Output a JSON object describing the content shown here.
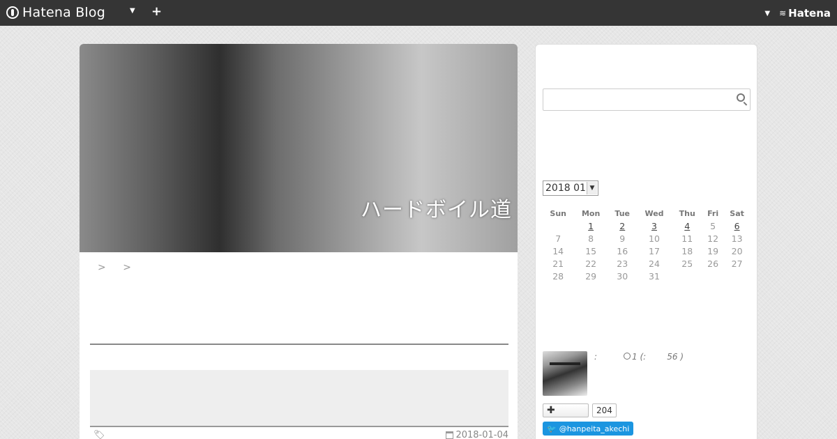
{
  "topbar": {
    "brand": "Hatena Blog",
    "add_label": "+",
    "right_brand": "Hatena",
    "right_mark": "≋"
  },
  "hero": {
    "title": "ハードボイル道"
  },
  "breadcrumb": [
    ">",
    ">"
  ],
  "entry": {
    "date": "2018-01-04"
  },
  "search": {
    "placeholder": ""
  },
  "calendar": {
    "selected_month": "2018 01",
    "weekdays": [
      "Sun",
      "Mon",
      "Tue",
      "Wed",
      "Thu",
      "Fri",
      "Sat"
    ],
    "weeks": [
      [
        "",
        "1",
        "2",
        "3",
        "4",
        "5",
        "6"
      ],
      [
        "7",
        "8",
        "9",
        "10",
        "11",
        "12",
        "13"
      ],
      [
        "14",
        "15",
        "16",
        "17",
        "18",
        "19",
        "20"
      ],
      [
        "21",
        "22",
        "23",
        "24",
        "25",
        "26",
        "27"
      ],
      [
        "28",
        "29",
        "30",
        "31",
        "",
        "",
        ""
      ]
    ],
    "linked_days": [
      "1",
      "2",
      "3",
      "4",
      "6"
    ]
  },
  "profile": {
    "colon": ":",
    "clock_value": "1 (:",
    "paren_value": "56 )",
    "follow_label": "✚",
    "follow_count": "204",
    "twitter_handle": "@hanpeita_akechi"
  }
}
